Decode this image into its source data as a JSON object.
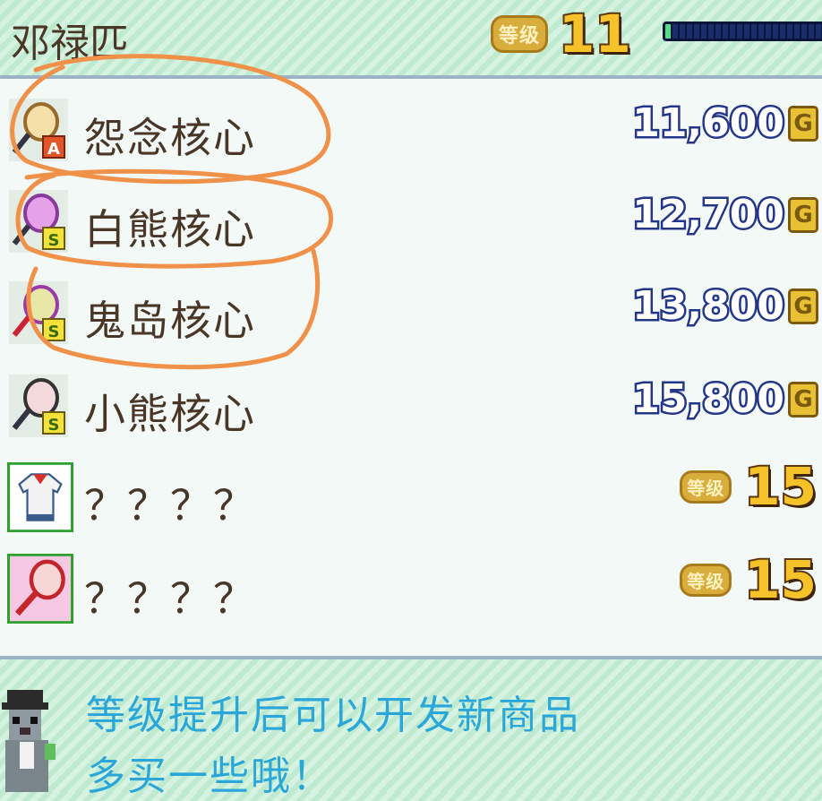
{
  "header": {
    "shop_name": "邓禄匹",
    "level_badge": "等级",
    "level": "11",
    "xp_progress": 0.03
  },
  "items": [
    {
      "name": "怨念核心",
      "price": "11,600",
      "currency": "G",
      "rank": "A",
      "icon": "racket-icon"
    },
    {
      "name": "白熊核心",
      "price": "12,700",
      "currency": "G",
      "rank": "S",
      "icon": "racket-icon"
    },
    {
      "name": "鬼岛核心",
      "price": "13,800",
      "currency": "G",
      "rank": "S",
      "icon": "racket-icon"
    },
    {
      "name": "小熊核心",
      "price": "15,800",
      "currency": "G",
      "rank": "S",
      "icon": "racket-icon"
    },
    {
      "name": "？？？？",
      "req_badge": "等级",
      "req_level": "15",
      "icon": "shirt-icon"
    },
    {
      "name": "？？？？",
      "req_badge": "等级",
      "req_level": "15",
      "icon": "racket-icon"
    }
  ],
  "hint": {
    "line1": "等级提升后可以开发新商品",
    "line2": "多买一些哦！"
  },
  "colors": {
    "price_outline": "#23368a",
    "level_gold": "#f6c22a",
    "hint_text": "#2aa7d8",
    "annotation_orange": "#f0914a"
  }
}
